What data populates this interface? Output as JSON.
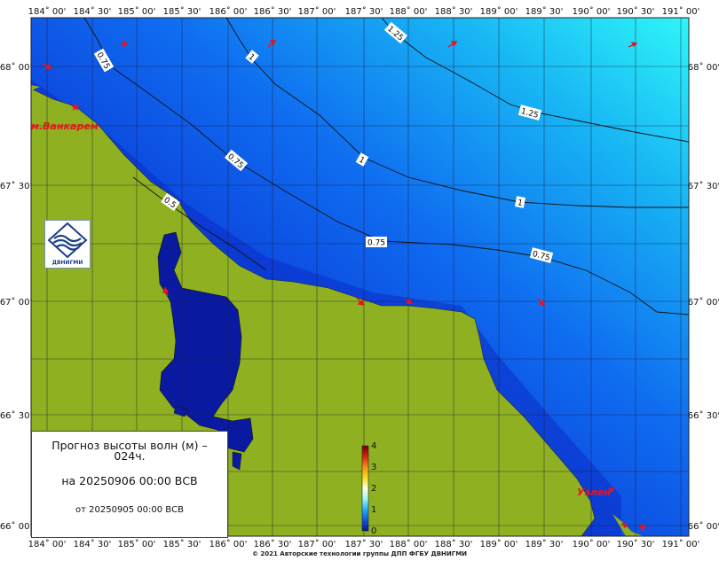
{
  "map": {
    "lon_labels": [
      "184˚ 00'",
      "184˚ 30'",
      "185˚ 00'",
      "185˚ 30'",
      "186˚ 00'",
      "186˚ 30'",
      "187˚ 00'",
      "187˚ 30'",
      "188˚ 00'",
      "188˚ 30'",
      "189˚ 00'",
      "189˚ 30'",
      "190˚ 00'",
      "190˚ 30'",
      "191˚ 00'"
    ],
    "lat_labels": [
      "68˚ 00'",
      "67˚ 30'",
      "67˚ 00'",
      "66˚ 30'",
      "66˚ 00'"
    ],
    "contour_labels": {
      "c075_top": "0.75",
      "c1_top": "1",
      "c125_top": "1.25",
      "c125_right": "1.25",
      "c075_mid": "0.75",
      "c1_mid": "1",
      "c1_right": "1",
      "c05": "0.5",
      "c075_low": "0.75",
      "c075_right": "0.75"
    },
    "places": {
      "vankarem": "м.Ванкарем",
      "uelen": "Уэлен"
    },
    "colors": {
      "land": "#8fb021",
      "sea_deep": "#0a1fb4",
      "sea_mid": "#0d5fe8",
      "sea_light": "#15c8f0",
      "sea_cyan": "#28f4f8",
      "arrow": "#e8141c",
      "contour": "#111111"
    }
  },
  "colorbar": {
    "ticks": [
      "0",
      "1",
      "2",
      "3",
      "4"
    ],
    "colors": [
      "#0a1a80",
      "#1060f0",
      "#30f0f8",
      "#ffffff",
      "#f0f020",
      "#f09018",
      "#c81010",
      "#7a0000"
    ]
  },
  "info": {
    "title": "Прогноз высоты волн (м) –  024ч.",
    "valid": "на 20250906 00:00 ВСВ",
    "issued": "от 20250905 00:00 ВСВ"
  },
  "logo": {
    "text": "ДВНИГМИ"
  },
  "footer": {
    "copyright": "© 2021 Авторские технологии группы ДПП ФГБУ ДВНИГМИ"
  }
}
